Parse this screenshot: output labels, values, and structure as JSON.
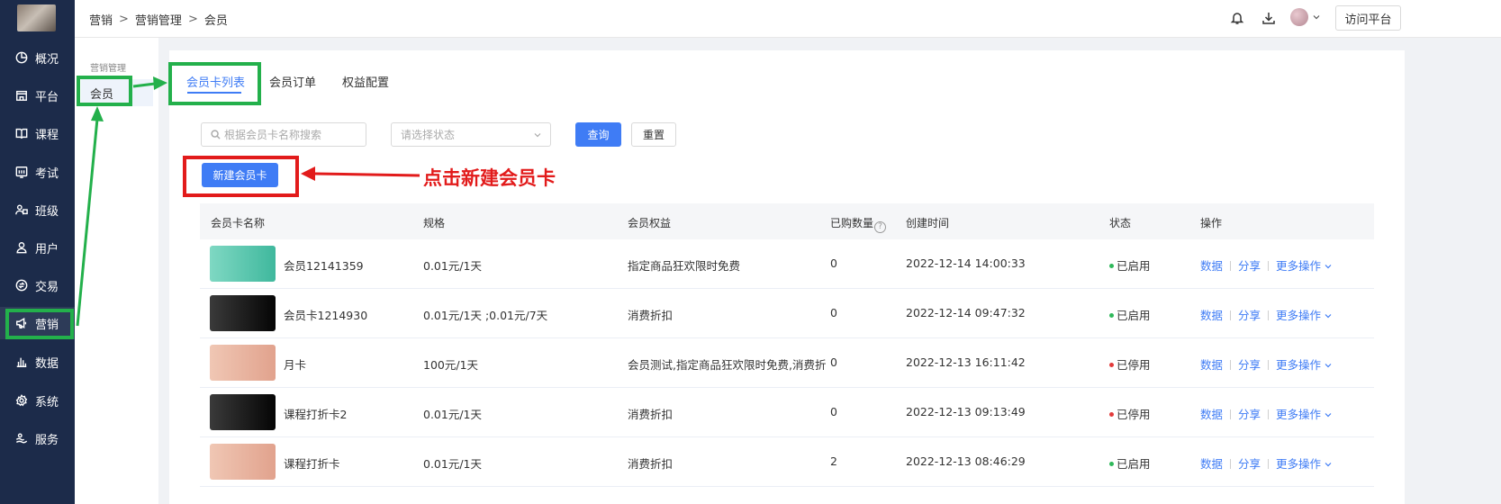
{
  "colors": {
    "nav_bg": "#1c2b4a",
    "primary": "#3f7cf5",
    "enabled": "#2fb85a",
    "disabled": "#e23b3b",
    "annotation_green": "#23b04b",
    "annotation_red": "#e21b1b"
  },
  "nav": {
    "items": [
      {
        "label": "概况",
        "icon": "pie-chart-icon"
      },
      {
        "label": "平台",
        "icon": "store-icon"
      },
      {
        "label": "课程",
        "icon": "book-icon"
      },
      {
        "label": "考试",
        "icon": "exam-icon"
      },
      {
        "label": "班级",
        "icon": "group-icon"
      },
      {
        "label": "用户",
        "icon": "user-icon"
      },
      {
        "label": "交易",
        "icon": "exchange-icon"
      },
      {
        "label": "营销",
        "icon": "megaphone-icon",
        "active": true
      },
      {
        "label": "数据",
        "icon": "bar-chart-icon"
      },
      {
        "label": "系统",
        "icon": "gear-icon"
      },
      {
        "label": "服务",
        "icon": "service-icon"
      }
    ]
  },
  "header": {
    "breadcrumb": [
      "营销",
      "营销管理",
      "会员"
    ],
    "visit_button": "访问平台"
  },
  "subnav": {
    "title": "营销管理",
    "items": [
      {
        "label": "会员",
        "active": true
      }
    ]
  },
  "tabs": [
    {
      "label": "会员卡列表",
      "active": true
    },
    {
      "label": "会员订单",
      "active": false
    },
    {
      "label": "权益配置",
      "active": false
    }
  ],
  "filters": {
    "search_placeholder": "根据会员卡名称搜索",
    "status_placeholder": "请选择状态",
    "query_button": "查询",
    "reset_button": "重置"
  },
  "create_button": "新建会员卡",
  "annotation_text": "点击新建会员卡",
  "table": {
    "columns": [
      "会员卡名称",
      "规格",
      "会员权益",
      "已购数量",
      "创建时间",
      "状态",
      "操作"
    ],
    "ops": {
      "data": "数据",
      "share": "分享",
      "more": "更多操作"
    },
    "rows": [
      {
        "name": "会员12141359",
        "spec": "0.01元/1天",
        "benefit": "指定商品狂欢限时免费",
        "bought": "0",
        "created": "2022-12-14 14:00:33",
        "status": "已启用",
        "status_type": "enabled",
        "thumb": "teal"
      },
      {
        "name": "会员卡1214930",
        "spec": "0.01元/1天 ;0.01元/7天",
        "benefit": "消费折扣",
        "bought": "0",
        "created": "2022-12-14 09:47:32",
        "status": "已启用",
        "status_type": "enabled",
        "thumb": "black"
      },
      {
        "name": "月卡",
        "spec": "100元/1天",
        "benefit": "会员测试,指定商品狂欢限时免费,消费折扣",
        "bought": "0",
        "created": "2022-12-13 16:11:42",
        "status": "已停用",
        "status_type": "disabled",
        "thumb": "peach"
      },
      {
        "name": "课程打折卡2",
        "spec": "0.01元/1天",
        "benefit": "消费折扣",
        "bought": "0",
        "created": "2022-12-13 09:13:49",
        "status": "已停用",
        "status_type": "disabled",
        "thumb": "black"
      },
      {
        "name": "课程打折卡",
        "spec": "0.01元/1天",
        "benefit": "消费折扣",
        "bought": "2",
        "created": "2022-12-13 08:46:29",
        "status": "已启用",
        "status_type": "enabled",
        "thumb": "peach"
      }
    ]
  }
}
